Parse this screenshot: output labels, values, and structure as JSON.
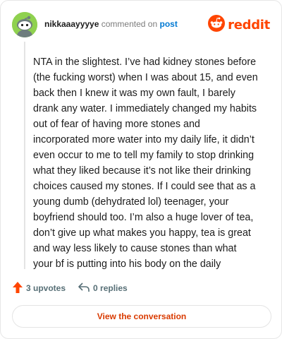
{
  "header": {
    "username": "nikkaaayyyye",
    "action_text": "commented on",
    "post_link": "post",
    "brand": "reddit"
  },
  "comment": {
    "body": "NTA in the slightest. I’ve had kidney stones before (the fucking worst) when I was about 15, and even back then I knew it was my own fault, I barely drank any water. I immediately changed my habits out of fear of having more stones and incorporated more water into my daily life, it didn’t even occur to me to tell my family to stop drinking what they liked because it’s not like their drinking choices caused my stones. If I could see that as a young dumb (dehydrated lol) teenager, your boyfriend should too. I’m also a huge lover of tea, don’t give up what makes you happy, tea is great and way less likely to cause stones than what your bf is putting into his body on the daily"
  },
  "actions": {
    "upvotes": "3 upvotes",
    "replies": "0 replies"
  },
  "footer": {
    "view_button": "View the conversation"
  },
  "colors": {
    "brand": "#ff4500",
    "link": "#0079d3",
    "button_text": "#d93a00",
    "avatar_bg": "#8fd14f"
  },
  "icons": {
    "avatar": "snoo-avatar-icon",
    "brand": "reddit-logo-icon",
    "upvote": "upvote-arrow-icon",
    "reply": "reply-arrow-icon"
  }
}
